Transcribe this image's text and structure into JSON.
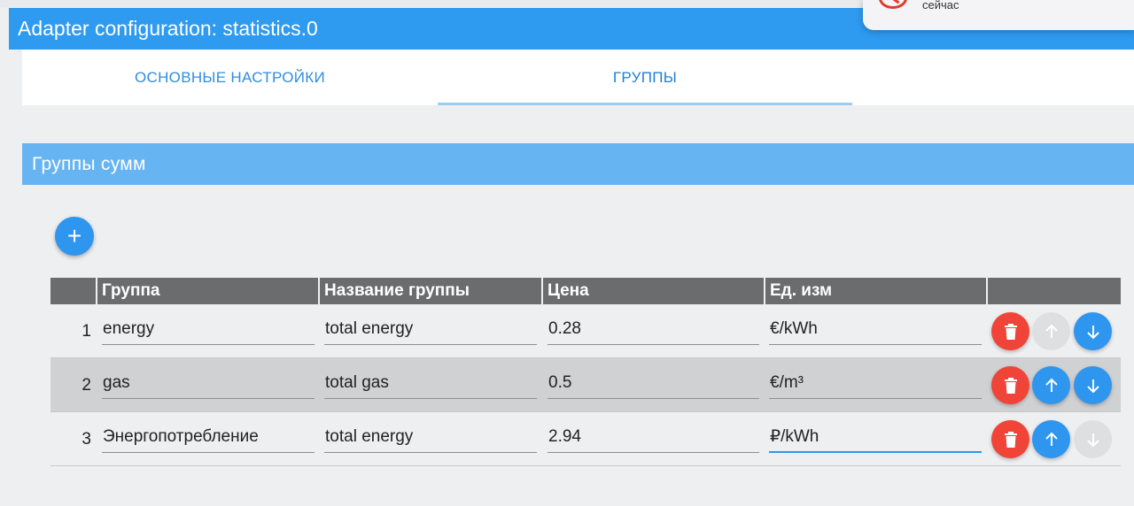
{
  "window": {
    "title": "Adapter configuration: statistics.0"
  },
  "notification": {
    "time": "сейчас",
    "icon": "alarm-clock-icon"
  },
  "tabs": [
    {
      "label": "ОСНОВНЫЕ НАСТРОЙКИ",
      "active": false
    },
    {
      "label": "ГРУППЫ",
      "active": true
    }
  ],
  "section": {
    "title": "Группы сумм"
  },
  "add_button": {
    "label": "+",
    "icon": "plus-icon"
  },
  "table": {
    "columns": [
      "Группа",
      "Название группы",
      "Цена",
      "Ед. изм"
    ],
    "rows": [
      {
        "num": "1",
        "group": "energy",
        "name": "total energy",
        "price": "0.28",
        "unit": "€/kWh",
        "up_enabled": false,
        "down_enabled": true
      },
      {
        "num": "2",
        "group": "gas",
        "name": "total gas",
        "price": "0.5",
        "unit": "€/m³",
        "up_enabled": true,
        "down_enabled": true
      },
      {
        "num": "3",
        "group": "Энергопотребление",
        "name": "total energy",
        "price": "2.94",
        "unit": "₽/kWh",
        "up_enabled": true,
        "down_enabled": false
      }
    ]
  },
  "colors": {
    "primary": "#2e96ef",
    "header": "#67b4f3",
    "delete": "#f04438",
    "disabled": "#dedfe1"
  }
}
